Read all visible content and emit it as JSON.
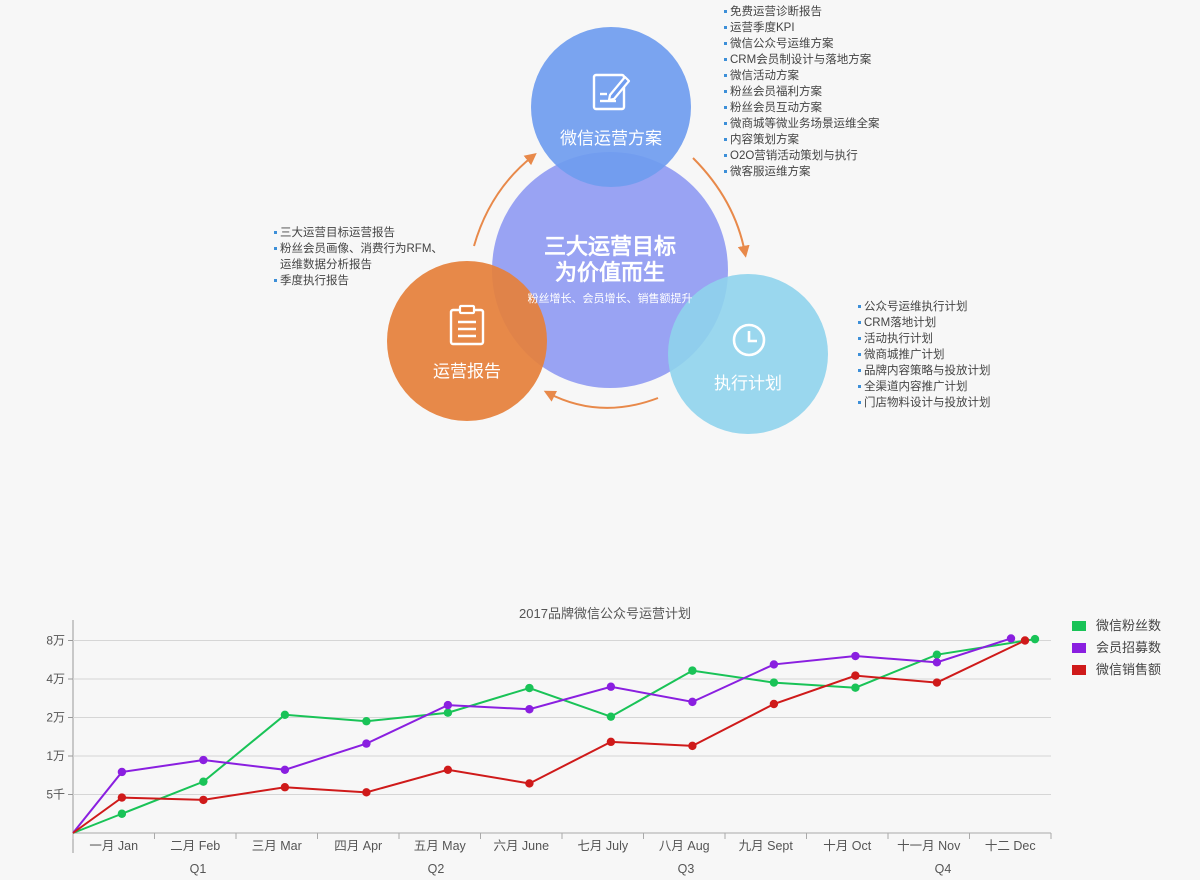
{
  "diagram": {
    "center": {
      "title_line1": "三大运营目标",
      "title_line2": "为价值而生",
      "subtitle": "粉丝增长、会员增长、销售额提升"
    },
    "plan": {
      "label": "微信运营方案",
      "items": [
        "免费运营诊断报告",
        "运营季度KPI",
        "微信公众号运维方案",
        "CRM会员制设计与落地方案",
        "微信活动方案",
        "粉丝会员福利方案",
        "粉丝会员互动方案",
        "微商城等微业务场景运维全案",
        "内容策划方案",
        "O2O营销活动策划与执行",
        "微客服运维方案"
      ]
    },
    "exec": {
      "label": "执行计划",
      "items": [
        "公众号运维执行计划",
        "CRM落地计划",
        "活动执行计划",
        "微商城推广计划",
        "品牌内容策略与投放计划",
        "全渠道内容推广计划",
        "门店物料设计与投放计划"
      ]
    },
    "report": {
      "label": "运营报告",
      "items": [
        "三大运营目标运营报告",
        "粉丝会员画像、消费行为RFM、",
        "运维数据分析报告",
        "季度执行报告"
      ]
    },
    "icons": {
      "plan": "edit-document-icon",
      "exec": "clock-icon",
      "report": "clipboard-icon"
    },
    "colors": {
      "plan": "#6f9cef",
      "center": "#8c97f2",
      "exec": "#8fd3ec",
      "report": "#e5803b",
      "arrow": "#e8894a"
    }
  },
  "chart_data": {
    "type": "line",
    "title": "2017品牌微信公众号运营计划",
    "categories": [
      "一月 Jan",
      "二月 Feb",
      "三月 Mar",
      "四月 Apr",
      "五月 May",
      "六月 June",
      "七月 July",
      "八月 Aug",
      "九月 Sept",
      "十月 Oct",
      "十一月 Nov",
      "十二 Dec"
    ],
    "quarters": [
      "Q1",
      "Q2",
      "Q3",
      "Q4"
    ],
    "y_ticks": [
      {
        "label": "5千",
        "value": 5000
      },
      {
        "label": "1万",
        "value": 10000
      },
      {
        "label": "2万",
        "value": 20000
      },
      {
        "label": "4万",
        "value": 40000
      },
      {
        "label": "8万",
        "value": 80000
      }
    ],
    "y_scale": "log",
    "y_tick_levels": [
      1,
      2,
      3,
      4,
      5
    ],
    "grid": true,
    "legend_position": "right",
    "series": [
      {
        "name": "微信粉丝数",
        "color": "#19c357",
        "values": [
          2500,
          6300,
          21000,
          18700,
          21800,
          34000,
          20300,
          46500,
          37500,
          34200,
          62000,
          82000
        ]
      },
      {
        "name": "会员招募数",
        "color": "#8a1fe0",
        "values": [
          7500,
          9300,
          7800,
          12500,
          25000,
          23200,
          34800,
          26500,
          52000,
          60500,
          54000,
          83000
        ]
      },
      {
        "name": "微信销售额",
        "color": "#cf1a1a",
        "values": [
          4600,
          4300,
          5700,
          5200,
          7800,
          6100,
          12900,
          12000,
          25500,
          42500,
          37500,
          80000
        ]
      }
    ]
  }
}
